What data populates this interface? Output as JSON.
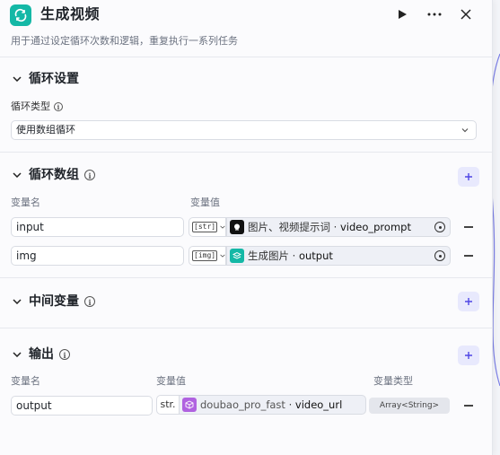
{
  "header": {
    "title": "生成视频",
    "subtitle": "用于通过设定循环次数和逻辑，重复执行一系列任务",
    "run_icon": "play-icon",
    "more_icon": "more-icon",
    "close_icon": "close-icon"
  },
  "loop_settings": {
    "title": "循环设置",
    "type_label": "循环类型",
    "type_value": "使用数组循环"
  },
  "loop_array": {
    "title": "循环数组",
    "col_name": "变量名",
    "col_value": "变量值",
    "rows": [
      {
        "name": "input",
        "type_tag": "[str]",
        "ref_source": "图片、视频提示词",
        "ref_sep": " · ",
        "ref_var": "video_prompt"
      },
      {
        "name": "img",
        "type_tag": "[img]",
        "ref_source": "生成图片",
        "ref_sep": " · ",
        "ref_var": "output"
      }
    ]
  },
  "intermediate": {
    "title": "中间变量"
  },
  "output": {
    "title": "输出",
    "col_name": "变量名",
    "col_value": "变量值",
    "col_type": "变量类型",
    "rows": [
      {
        "name": "output",
        "type_tag": "str.",
        "ref_source": "doubao_pro_fast",
        "ref_sep": " · ",
        "ref_var": "video_url",
        "var_type": "Array<String>"
      }
    ]
  },
  "colors": {
    "accent": "#14b8a6",
    "plus_bg": "#e8e9fd",
    "plus_fg": "#4f46e5",
    "ref_bg": "#eef0f6",
    "ref_icon_dark": "#111111",
    "ref_icon_teal": "#14b8a6",
    "ref_icon_purple": "#b062e0"
  }
}
